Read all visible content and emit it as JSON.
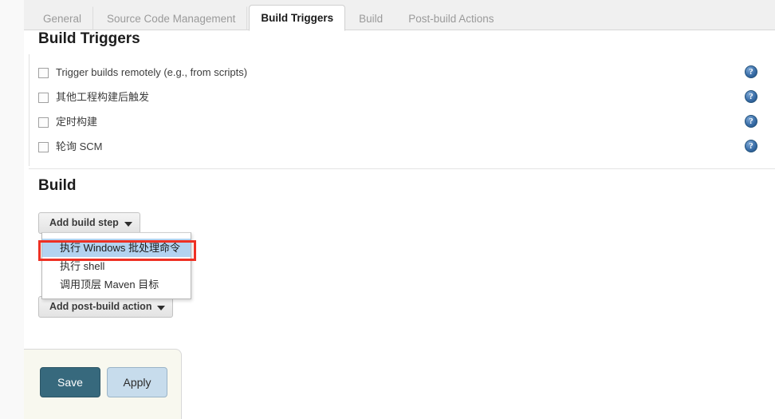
{
  "tabs": [
    {
      "label": "General",
      "active": false
    },
    {
      "label": "Source Code Management",
      "active": false
    },
    {
      "label": "Build Triggers",
      "active": true
    },
    {
      "label": "Build",
      "active": false
    },
    {
      "label": "Post-build Actions",
      "active": false
    }
  ],
  "sections": {
    "build_triggers": {
      "title": "Build Triggers",
      "checkboxes": [
        {
          "label": "Trigger builds remotely (e.g., from scripts)",
          "checked": false,
          "help": "?"
        },
        {
          "label": "其他工程构建后触发",
          "checked": false,
          "help": "?"
        },
        {
          "label": "定时构建",
          "checked": false,
          "help": "?"
        },
        {
          "label": "轮询 SCM",
          "checked": false,
          "help": "?"
        }
      ]
    },
    "build": {
      "title": "Build",
      "add_build_step_label": "Add build step",
      "add_post_build_label": "Add post-build action",
      "dropdown_open": true,
      "dropdown_items": [
        {
          "label": "执行 Windows 批处理命令",
          "selected": true
        },
        {
          "label": "执行 shell",
          "selected": false
        },
        {
          "label": "调用顶层 Maven 目标",
          "selected": false
        }
      ]
    }
  },
  "footer": {
    "save_label": "Save",
    "apply_label": "Apply"
  },
  "icons": {
    "help": "help-icon",
    "caret": "chevron-down-icon"
  },
  "colors": {
    "accent_save": "#37697d",
    "accent_apply": "#c7dcec",
    "highlight_border": "#ee3124",
    "menu_selected": "#b3d3f0",
    "help_icon": "#3a6ea8"
  }
}
